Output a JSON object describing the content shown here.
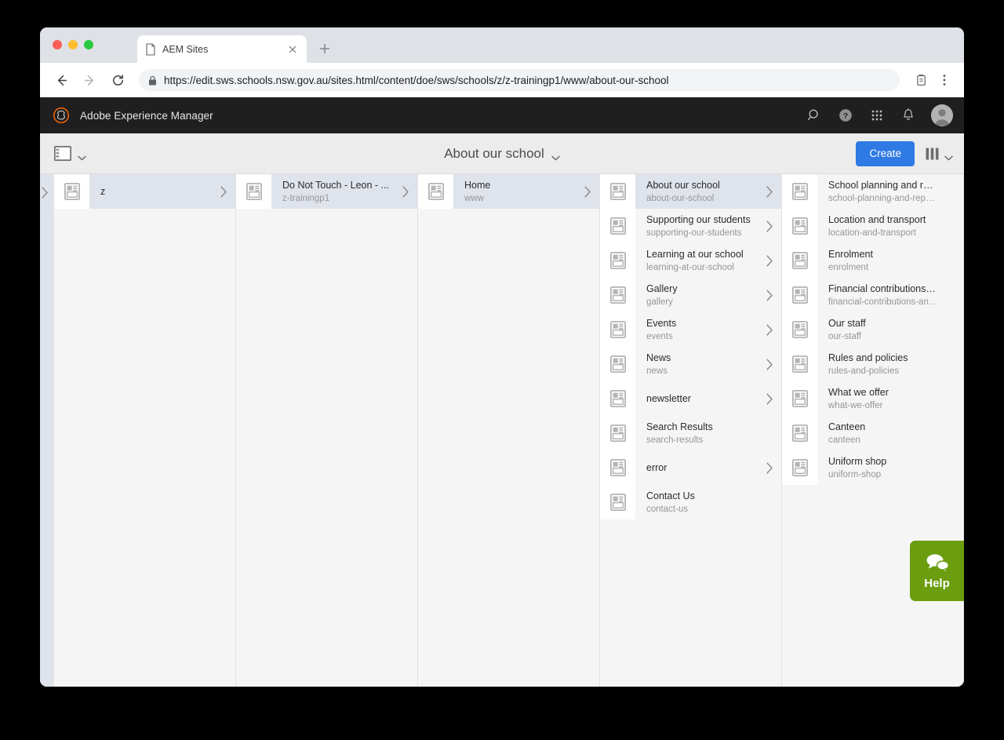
{
  "browser": {
    "tab": {
      "title": "AEM Sites"
    },
    "url_secure_prefix": "https://",
    "url_host": "edit.sws.schools.nsw.gov.au",
    "url_path": "/sites.html/content/doe/sws/schools/z/z-trainingp1/www/about-our-school",
    "url_full": "https://edit.sws.schools.nsw.gov.au/sites.html/content/doe/sws/schools/z/z-trainingp1/www/about-our-school"
  },
  "aem": {
    "brand": "Adobe Experience Manager",
    "brand_accent": "#e8620a",
    "header_bg": "#1f1f1f",
    "header_icons": [
      {
        "name": "search-icon"
      },
      {
        "name": "help-icon"
      },
      {
        "name": "apps-grid-icon"
      },
      {
        "name": "notifications-bell-icon"
      },
      {
        "name": "avatar"
      }
    ]
  },
  "toolbar": {
    "rail_icon": "rail-toggle-icon",
    "title": "About our school",
    "create_label": "Create",
    "create_color": "#2f7ae5",
    "view_icon": "column-view-icon"
  },
  "columns": [
    {
      "id": "col-1",
      "items": [
        {
          "title": "z",
          "sub": "",
          "chevron": true,
          "selected": true
        }
      ]
    },
    {
      "id": "col-2",
      "items": [
        {
          "title": "Do Not Touch - Leon - ...",
          "sub": "z-trainingp1",
          "chevron": true,
          "selected": true
        }
      ]
    },
    {
      "id": "col-3",
      "items": [
        {
          "title": "Home",
          "sub": "www",
          "chevron": true,
          "selected": true
        }
      ]
    },
    {
      "id": "col-4",
      "items": [
        {
          "title": "About our school",
          "sub": "about-our-school",
          "chevron": true,
          "selected": true
        },
        {
          "title": "Supporting our students",
          "sub": "supporting-our-students",
          "chevron": true,
          "selected": false
        },
        {
          "title": "Learning at our school",
          "sub": "learning-at-our-school",
          "chevron": true,
          "selected": false
        },
        {
          "title": "Gallery",
          "sub": "gallery",
          "chevron": true,
          "selected": false
        },
        {
          "title": "Events",
          "sub": "events",
          "chevron": true,
          "selected": false
        },
        {
          "title": "News",
          "sub": "news",
          "chevron": true,
          "selected": false
        },
        {
          "title": "newsletter",
          "sub": "",
          "chevron": true,
          "selected": false
        },
        {
          "title": "Search Results",
          "sub": "search-results",
          "chevron": false,
          "selected": false
        },
        {
          "title": "error",
          "sub": "",
          "chevron": true,
          "selected": false
        },
        {
          "title": "Contact Us",
          "sub": "contact-us",
          "chevron": false,
          "selected": false
        }
      ]
    },
    {
      "id": "col-5",
      "items": [
        {
          "title": "School planning and reporting",
          "sub": "school-planning-and-reporting",
          "chevron": false,
          "selected": false
        },
        {
          "title": "Location and transport",
          "sub": "location-and-transport",
          "chevron": false,
          "selected": false
        },
        {
          "title": "Enrolment",
          "sub": "enrolment",
          "chevron": false,
          "selected": false
        },
        {
          "title": "Financial contributions and as...",
          "sub": "financial-contributions-and-as...",
          "chevron": false,
          "selected": false
        },
        {
          "title": "Our staff",
          "sub": "our-staff",
          "chevron": false,
          "selected": false
        },
        {
          "title": "Rules and policies",
          "sub": "rules-and-policies",
          "chevron": false,
          "selected": false
        },
        {
          "title": "What we offer",
          "sub": "what-we-offer",
          "chevron": false,
          "selected": false
        },
        {
          "title": "Canteen",
          "sub": "canteen",
          "chevron": false,
          "selected": false
        },
        {
          "title": "Uniform shop",
          "sub": "uniform-shop",
          "chevron": false,
          "selected": false
        }
      ]
    }
  ],
  "help_widget": {
    "label": "Help",
    "color": "#6b9d0f",
    "icon": "chat-bubbles-icon"
  }
}
